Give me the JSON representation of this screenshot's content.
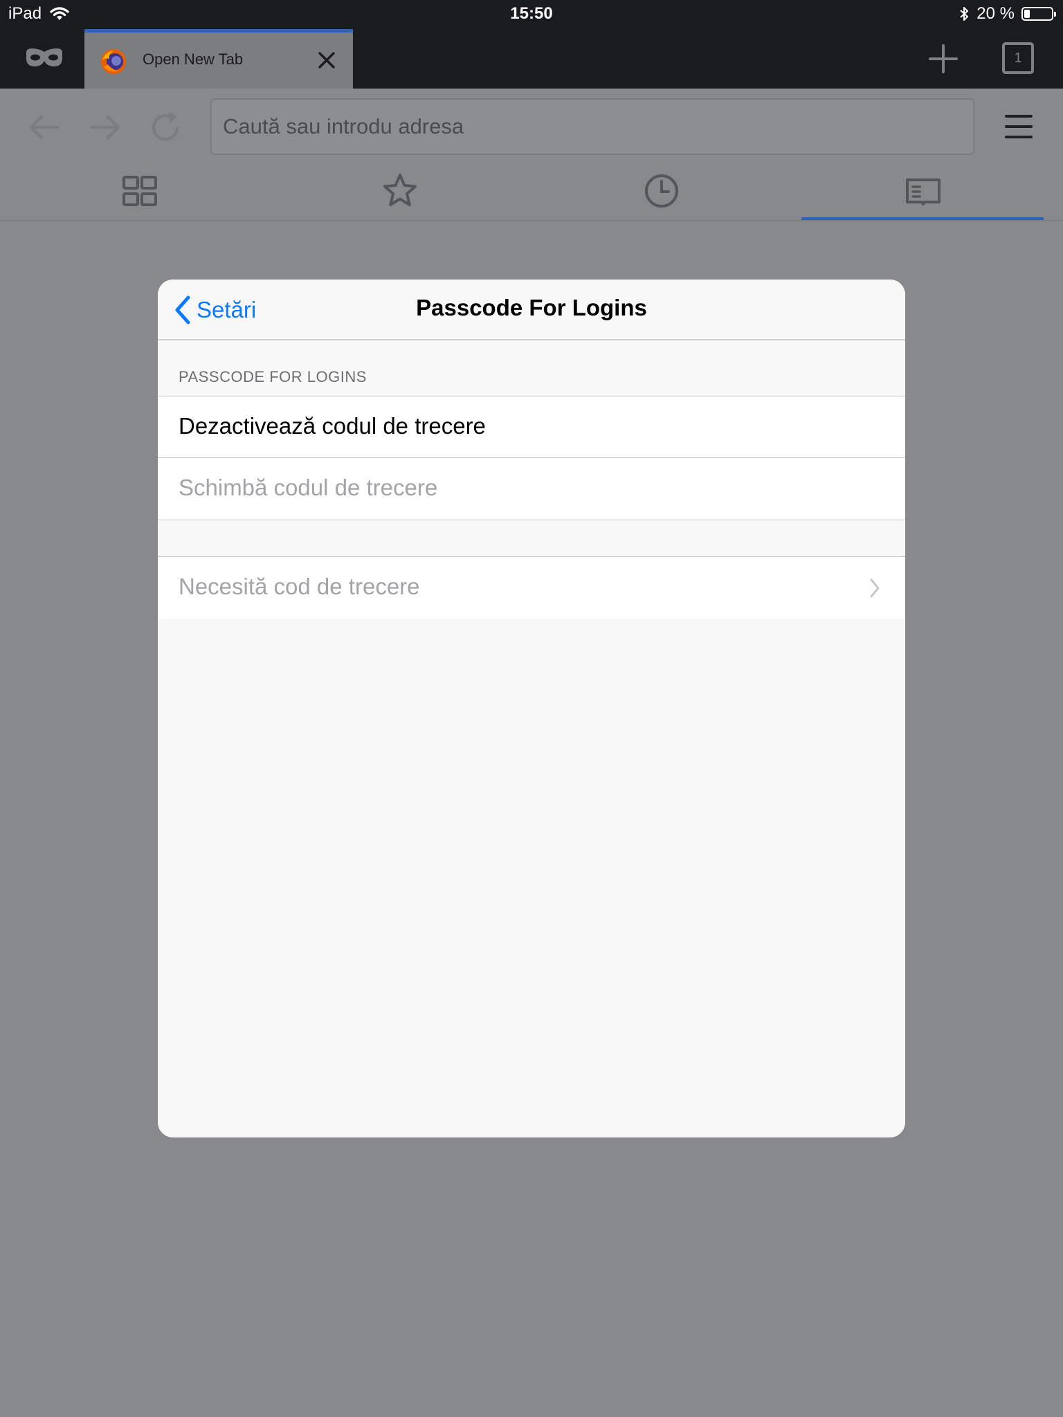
{
  "status_bar": {
    "device": "iPad",
    "time": "15:50",
    "battery_text": "20 %",
    "battery_level": 0.2,
    "icons": [
      "wifi-icon",
      "bluetooth-icon",
      "battery-icon"
    ]
  },
  "tabs": {
    "active_tab_title": "Open New Tab",
    "tab_count": "1"
  },
  "toolbar": {
    "url_placeholder": "Caută sau introdu adresa"
  },
  "panel_tabs": [
    "top-sites",
    "bookmarks",
    "history",
    "reading-list"
  ],
  "modal": {
    "back_label": "Setări",
    "title": "Passcode For Logins",
    "section_header": "PASSCODE FOR LOGINS",
    "rows": [
      {
        "label": "Dezactivează codul de trecere",
        "enabled": true
      },
      {
        "label": "Schimbă codul de trecere",
        "enabled": false
      },
      {
        "label": "Necesită cod de trecere",
        "enabled": false
      }
    ]
  },
  "colors": {
    "accent": "#0a7aff",
    "tab_indicator": "#2f63b5",
    "status_bar_bg": "#1a1b1f",
    "dimmed_background": "#88898d"
  }
}
